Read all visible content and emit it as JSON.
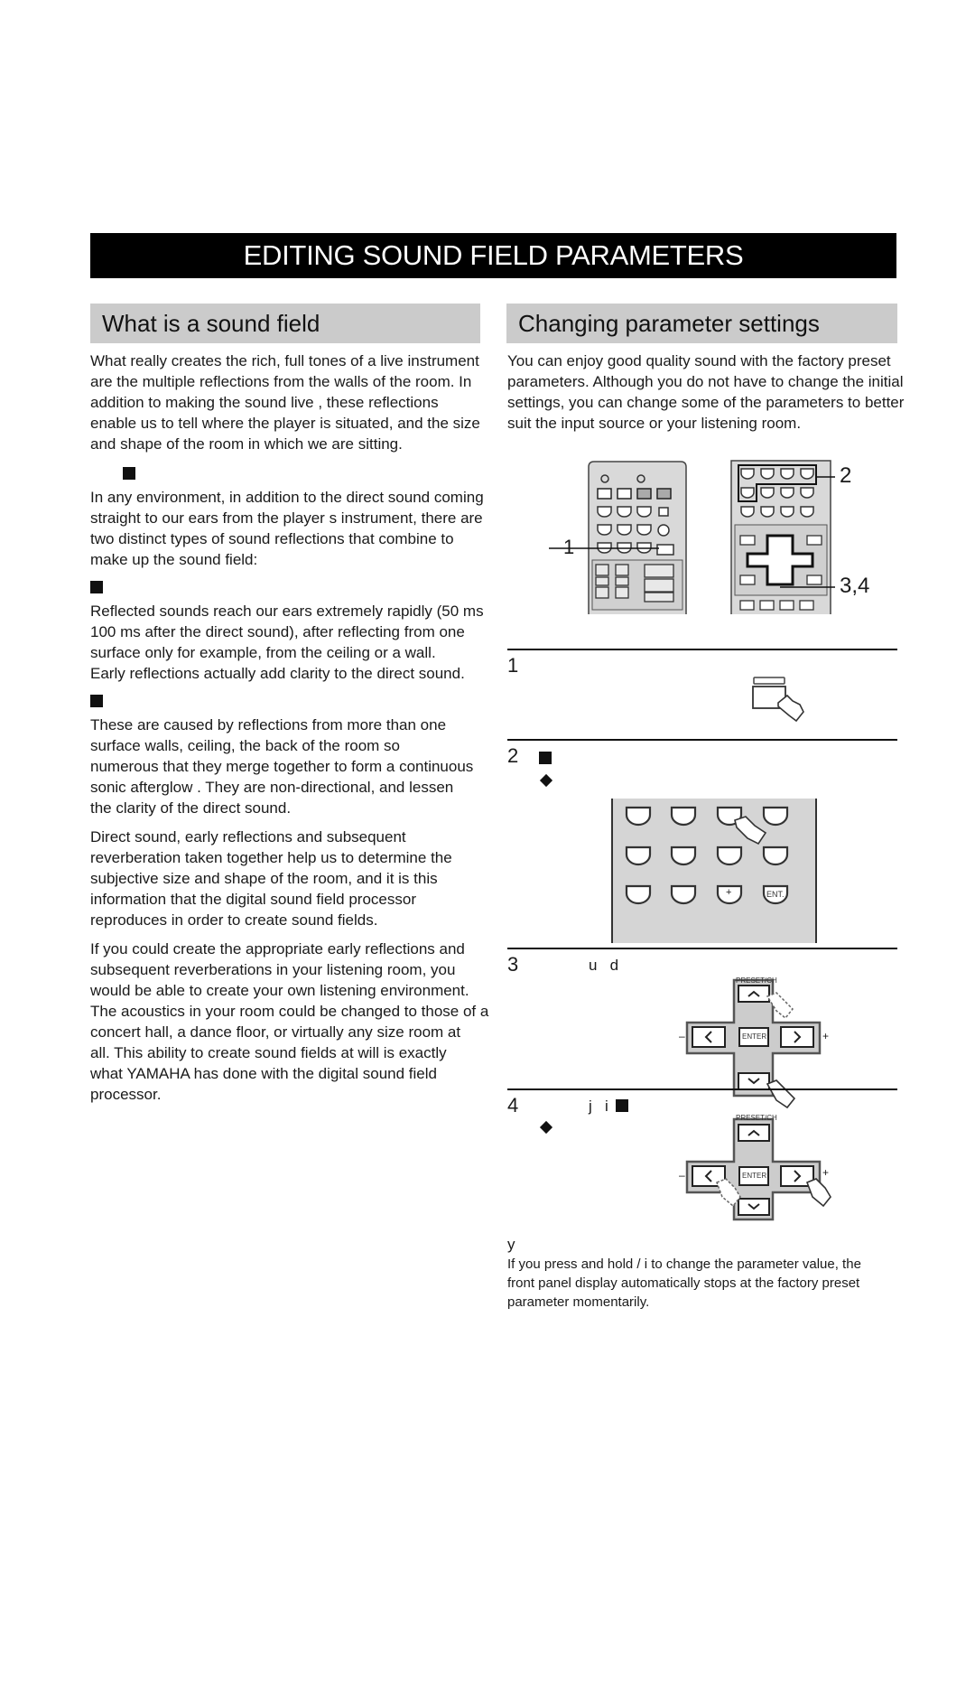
{
  "page": {
    "title": "EDITING SOUND FIELD PARAMETERS"
  },
  "left": {
    "heading": "What is a sound field",
    "intro": [
      "What really creates the rich, full tones of a live instrument",
      "are the multiple reflections from the walls of the room. In",
      "addition to making the sound  live , these reflections",
      "enable us to tell where the player is situated, and the size",
      "and shape of the room in which we are sitting."
    ],
    "env": [
      "In any environment, in addition to the direct sound coming",
      "straight to our ears from the player s instrument, there are",
      "two distinct types of sound reflections that combine to",
      "make up the sound field:"
    ],
    "early": [
      "Reflected sounds reach our ears extremely rapidly (50 ms",
      "  100 ms after the direct sound), after reflecting from one",
      "surface only   for example, from the ceiling or a wall.",
      "Early reflections actually add clarity to the direct sound."
    ],
    "reverb": [
      "These are caused by reflections from more than one",
      "surface   walls, ceiling, the back of the room   so",
      "numerous that they merge together to form a continuous",
      "sonic  afterglow . They are non-directional, and lessen",
      "the clarity of the direct sound."
    ],
    "direct": [
      "Direct sound, early reflections and subsequent",
      "reverberation taken together help us to determine the",
      "subjective size and shape of the room, and it is this",
      "information that the digital sound field processor",
      "reproduces in order to create sound fields."
    ],
    "create": [
      "If you could create the appropriate early reflections and",
      "subsequent reverberations in your listening room, you",
      "would be able to create your own listening environment.",
      "The acoustics in your room could be changed to those of a",
      "concert hall, a dance floor, or virtually any size room at",
      "all. This ability to create sound fields at will is exactly",
      "what YAMAHA has done with the digital sound field",
      "processor."
    ]
  },
  "right": {
    "heading": "Changing parameter settings",
    "intro": [
      "You can enjoy good quality sound with the factory preset",
      "parameters. Although you do not have to change the initial",
      "settings, you can change some of the parameters to better",
      "suit the input source or your listening room."
    ],
    "callouts": {
      "one": "1",
      "two": "2",
      "three_four": "3,4"
    },
    "steps": [
      {
        "num": "1",
        "text": ""
      },
      {
        "num": "2",
        "text": ""
      },
      {
        "num": "3",
        "text": "u   d"
      },
      {
        "num": "4",
        "text": "j   i"
      }
    ],
    "keypad": {
      "plus_label": "+",
      "ent_label": "ENT."
    },
    "dpad": {
      "top_label": "PRESET/CH",
      "center_label": "ENTER",
      "minus": "–",
      "plus": "+"
    },
    "note": {
      "marker": "y",
      "lines": [
        "If you press and hold  / i  to change the parameter value, the",
        "front panel display automatically stops at the factory preset",
        "parameter momentarily."
      ]
    }
  }
}
